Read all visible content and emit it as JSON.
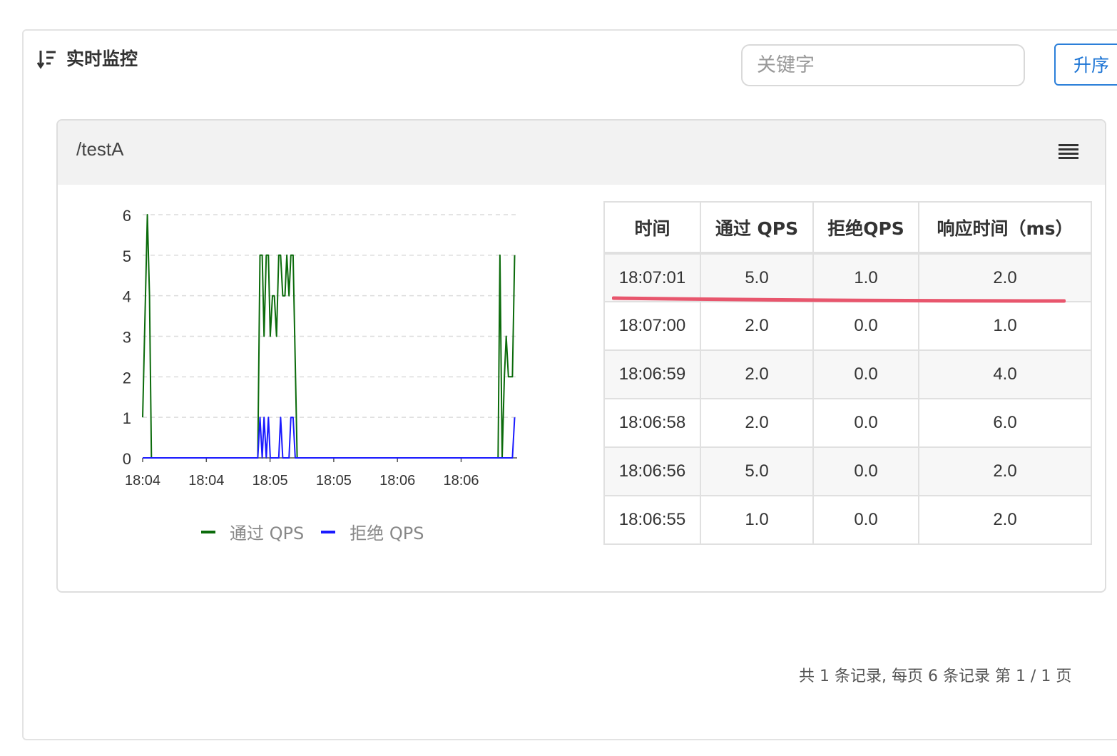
{
  "header": {
    "title": "实时监控",
    "icon": "sort-descending-icon"
  },
  "search": {
    "placeholder": "关键字"
  },
  "sort_button": {
    "label": "升序"
  },
  "card": {
    "title": "/testA",
    "menu_icon": "menu-lines-icon"
  },
  "legend": [
    {
      "label": "通过 QPS",
      "color": "#0b6b0b"
    },
    {
      "label": "拒绝 QPS",
      "color": "#1a1aff"
    }
  ],
  "chart_data": {
    "type": "line",
    "x_tick_labels": [
      "18:04",
      "18:04",
      "18:05",
      "18:05",
      "18:06",
      "18:06"
    ],
    "ylim": [
      0,
      6
    ],
    "y_ticks": [
      "0",
      "1",
      "2",
      "3",
      "4",
      "5",
      "6"
    ],
    "grid": "horizontal dashed",
    "legend_position": "bottom",
    "series": [
      {
        "name": "通过 QPS",
        "color": "#0b6b0b",
        "points": [
          [
            0,
            1
          ],
          [
            1.5,
            6
          ],
          [
            2.2,
            4
          ],
          [
            2.8,
            0
          ],
          [
            36.9,
            0
          ],
          [
            37.6,
            5
          ],
          [
            38.3,
            5
          ],
          [
            38.9,
            3
          ],
          [
            39.6,
            5
          ],
          [
            40.3,
            5
          ],
          [
            40.9,
            3
          ],
          [
            41.6,
            4
          ],
          [
            42.2,
            4
          ],
          [
            42.9,
            3
          ],
          [
            43.6,
            5
          ],
          [
            44.2,
            5
          ],
          [
            44.9,
            4
          ],
          [
            45.6,
            4
          ],
          [
            46.2,
            5
          ],
          [
            46.9,
            4
          ],
          [
            47.5,
            5
          ],
          [
            48.2,
            5
          ],
          [
            49.5,
            0
          ],
          [
            113.9,
            0
          ],
          [
            114.5,
            5
          ],
          [
            115.2,
            0
          ],
          [
            115.9,
            2
          ],
          [
            116.5,
            3
          ],
          [
            117.2,
            2
          ],
          [
            118.5,
            2
          ],
          [
            119.2,
            5
          ]
        ]
      },
      {
        "name": "拒绝 QPS",
        "color": "#1a1aff",
        "points": [
          [
            0,
            0
          ],
          [
            36.9,
            0
          ],
          [
            37.6,
            1
          ],
          [
            38.3,
            0
          ],
          [
            38.9,
            1
          ],
          [
            39.6,
            0
          ],
          [
            40.3,
            1
          ],
          [
            40.9,
            0
          ],
          [
            43.6,
            0
          ],
          [
            44.2,
            1
          ],
          [
            44.9,
            0
          ],
          [
            46.9,
            0
          ],
          [
            47.5,
            1
          ],
          [
            48.2,
            1
          ],
          [
            48.9,
            0
          ],
          [
            118.5,
            0
          ],
          [
            119.2,
            1
          ]
        ]
      }
    ],
    "table": {
      "columns": [
        "时间",
        "通过 QPS",
        "拒绝QPS",
        "响应时间（ms）"
      ],
      "rows": [
        [
          "18:07:01",
          "5.0",
          "1.0",
          "2.0"
        ],
        [
          "18:07:00",
          "2.0",
          "0.0",
          "1.0"
        ],
        [
          "18:06:59",
          "2.0",
          "0.0",
          "4.0"
        ],
        [
          "18:06:58",
          "2.0",
          "0.0",
          "6.0"
        ],
        [
          "18:06:56",
          "5.0",
          "0.0",
          "2.0"
        ],
        [
          "18:06:55",
          "1.0",
          "0.0",
          "2.0"
        ]
      ]
    }
  },
  "annotation": {
    "highlight_color": "#e8566d"
  },
  "pagination": {
    "text": "共 1 条记录, 每页 6 条记录 第 1 / 1 页"
  }
}
